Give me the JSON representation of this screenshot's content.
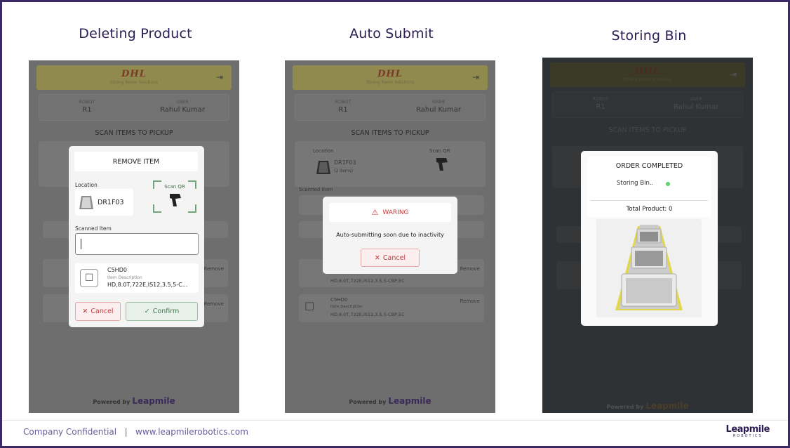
{
  "panels": {
    "p1_title": "Deleting Product",
    "p2_title": "Auto Submit",
    "p3_title": "Storing Bin"
  },
  "app": {
    "header_sub": "Strong Room Solutions",
    "brand": "DHL",
    "robot_label": "ROBOT",
    "robot_value": "R1",
    "user_label": "USER",
    "user_value": "Rahul Kumar",
    "scan_title": "SCAN ITEMS TO PICKUP",
    "powered_by": "Powered by",
    "powered_brand": "Leapmile",
    "location_label": "Location",
    "location_code": "DR1F03",
    "items_count": "(2 items)",
    "scan_qr": "Scan QR",
    "scanned_item": "Scanned Item",
    "remove": "Remove",
    "item_code": "C5HD0",
    "item_desc_label": "Item Description",
    "item_desc": "HD,8.0T,722E,IS12,3.5,5-CBP,EC"
  },
  "remove_modal": {
    "title": "REMOVE ITEM",
    "location_label": "Location",
    "location_code": "DR1F03",
    "scan_qr": "Scan QR",
    "scanned_label": "Scanned Item",
    "input_value": "",
    "item_code": "C5HD0",
    "item_desc_label": "Item Description",
    "item_desc": "HD,8.0T,722E,IS12,3.5,5-C...",
    "cancel": "Cancel",
    "confirm": "Confirm"
  },
  "warning_modal": {
    "title": "WARING",
    "message": "Auto-submitting soon due to inactivity",
    "cancel": "Cancel"
  },
  "order_modal": {
    "title": "ORDER COMPLETED",
    "status": "Storing Bin..",
    "total": "Total Product: 0"
  },
  "footer": {
    "text": "Company Confidential   |   www.leapmilerobotics.com",
    "logo": "Leapmile",
    "logo_sub": "ROBOTICS"
  },
  "colors": {
    "title": "#2b1d52",
    "border": "#3b2a63",
    "warning": "#d04040",
    "status_dot": "#5fd06e"
  }
}
